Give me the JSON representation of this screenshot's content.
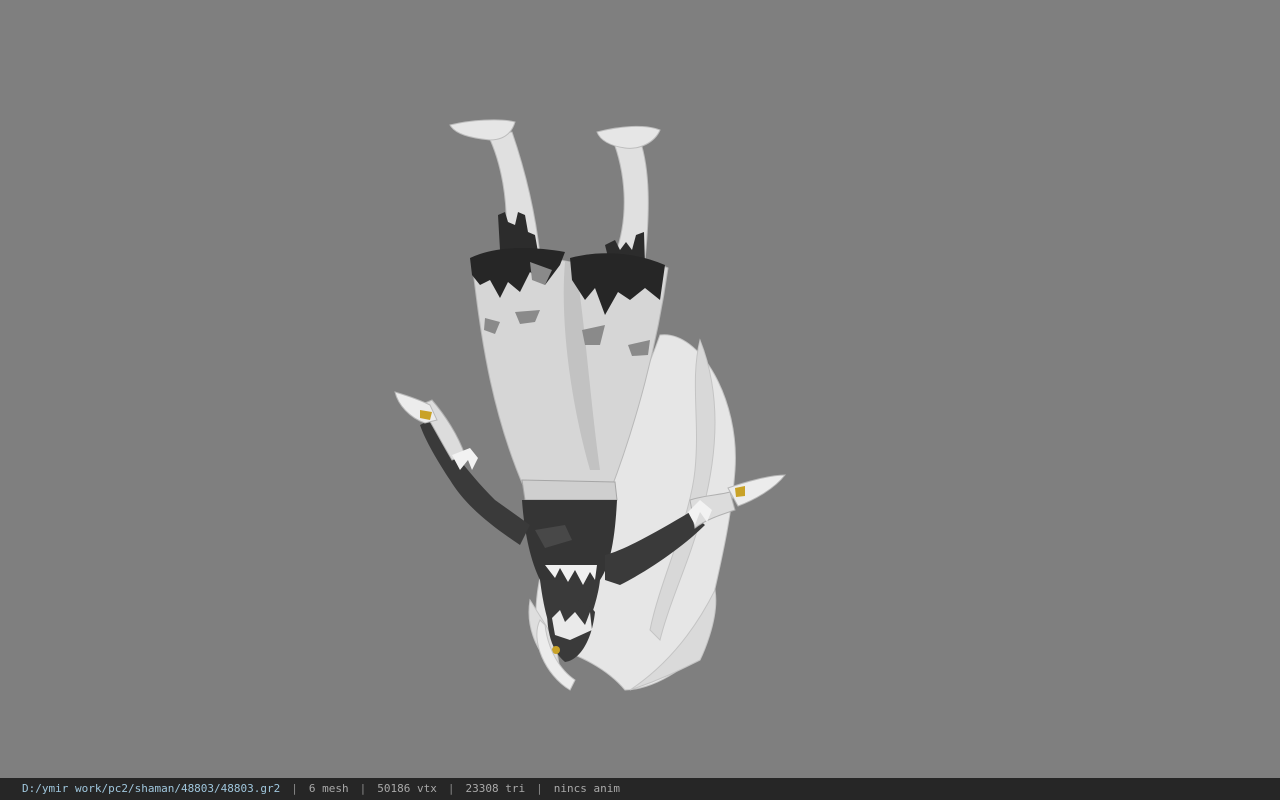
{
  "status_bar": {
    "file_path": "D:/ymir work/pc2/shaman/48803/48803.gr2",
    "separator": "|",
    "mesh_count": "6 mesh",
    "vertex_count": "50186 vtx",
    "triangle_count": "23308 tri",
    "anim_status": "nincs anim"
  },
  "viewport": {
    "background_color": "#7f7f7f",
    "model_colors": {
      "skin": "#e3e3e3",
      "cloth_light": "#d2d2d2",
      "cloth_dark": "#3a3a3a",
      "hair": "#ececec",
      "accent": "#c9a227"
    }
  }
}
